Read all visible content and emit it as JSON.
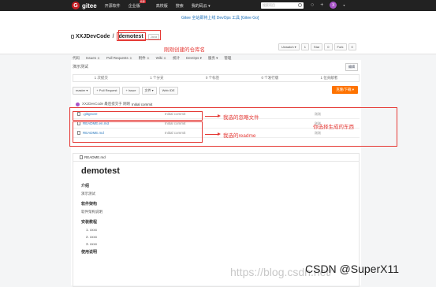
{
  "topbar": {
    "logo_mark": "G",
    "logo_text": "gitee",
    "nav": [
      "开源软件",
      "企业版",
      "高校版",
      "搜索",
      "我的码云 ▾"
    ],
    "badge": "特惠",
    "search_placeholder": "搜索项目",
    "plus": "+",
    "avatar": "X"
  },
  "banner": "Gitee 全站即将上线 DevOps 工具 [Gitee Go]",
  "repo": {
    "owner": "XXJDevCode",
    "name": "demotest",
    "visibility": "Java",
    "watch": "Unwatch ▾",
    "watch_count": "1",
    "star": "Star",
    "star_count": "0",
    "fork": "Fork",
    "fork_count": "0"
  },
  "tabs": [
    {
      "label": "代码",
      "count": ""
    },
    {
      "label": "Issues",
      "count": "0"
    },
    {
      "label": "Pull Requests",
      "count": "0"
    },
    {
      "label": "附件",
      "count": "0"
    },
    {
      "label": "Wiki",
      "count": "0"
    },
    {
      "label": "统计",
      "count": ""
    },
    {
      "label": "DevOps ▾",
      "count": ""
    },
    {
      "label": "服务 ▾",
      "count": ""
    },
    {
      "label": "管理",
      "count": ""
    }
  ],
  "description": "演示测试",
  "edit": "编辑",
  "stats": [
    "1 次提交",
    "1 个分支",
    "0 个标签",
    "0 个发行版",
    "1 位贡献者"
  ],
  "toolbar": [
    "master ▾",
    "+ Pull Request",
    "+ Issue",
    "文件 ▾",
    "Web IDE"
  ],
  "clone": "克隆/下载 ▾",
  "commit": {
    "author": "XXJDevCode 最后提交于 刚刚",
    "message": "Initial commit"
  },
  "files": [
    {
      "name": ".gitignore",
      "message": "Initial commit",
      "date": "刚刚"
    },
    {
      "name": "README.en.md",
      "message": "Initial commit",
      "date": "刚刚"
    },
    {
      "name": "README.md",
      "message": "Initial commit",
      "date": "刚刚"
    }
  ],
  "annotations": {
    "created": "刚刚创建的仓库名",
    "ignore": "我选的忽略文件",
    "readme": "我选的readme",
    "generated": "你选择生成的东西"
  },
  "readme": {
    "file": "README.md",
    "title": "demotest",
    "sections": [
      {
        "heading": "介绍",
        "text": "演示测试"
      },
      {
        "heading": "软件架构",
        "text": "软件架构说明"
      }
    ],
    "install_heading": "安装教程",
    "install_items": [
      "1. xxxx",
      "2. xxxx",
      "3. xxxx"
    ],
    "usage_heading": "使用说明"
  },
  "watermark": "https://blog.csdn.net/",
  "csdn": "CSDN @SuperX11"
}
